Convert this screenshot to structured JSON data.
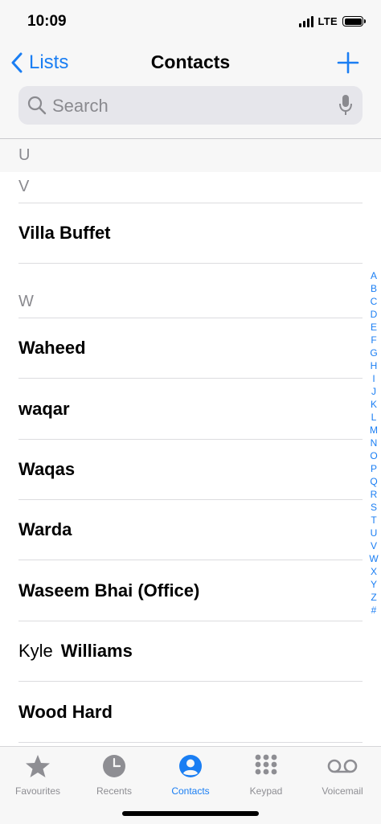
{
  "status": {
    "time": "10:09",
    "network": "LTE"
  },
  "nav": {
    "back_label": "Lists",
    "title": "Contacts"
  },
  "search": {
    "placeholder": "Search"
  },
  "sections": {
    "u": "U",
    "v": "V",
    "w": "W"
  },
  "contacts": [
    {
      "name": "Villa Buffet"
    },
    {
      "name": "Waheed"
    },
    {
      "name": "waqar"
    },
    {
      "name": "Waqas"
    },
    {
      "name": "Warda"
    },
    {
      "name": "Waseem Bhai (Office)"
    },
    {
      "first": "Kyle",
      "last": "Williams"
    },
    {
      "name": "Wood Hard"
    }
  ],
  "index": [
    "A",
    "B",
    "C",
    "D",
    "E",
    "F",
    "G",
    "H",
    "I",
    "J",
    "K",
    "L",
    "M",
    "N",
    "O",
    "P",
    "Q",
    "R",
    "S",
    "T",
    "U",
    "V",
    "W",
    "X",
    "Y",
    "Z",
    "#"
  ],
  "tabs": [
    {
      "label": "Favourites",
      "icon": "star-icon"
    },
    {
      "label": "Recents",
      "icon": "clock-icon"
    },
    {
      "label": "Contacts",
      "icon": "person-circle-icon",
      "active": true
    },
    {
      "label": "Keypad",
      "icon": "keypad-icon"
    },
    {
      "label": "Voicemail",
      "icon": "voicemail-icon"
    }
  ],
  "colors": {
    "accent": "#1a7ef3",
    "inactive": "#8e8e93",
    "section": "#8a8a8f"
  }
}
